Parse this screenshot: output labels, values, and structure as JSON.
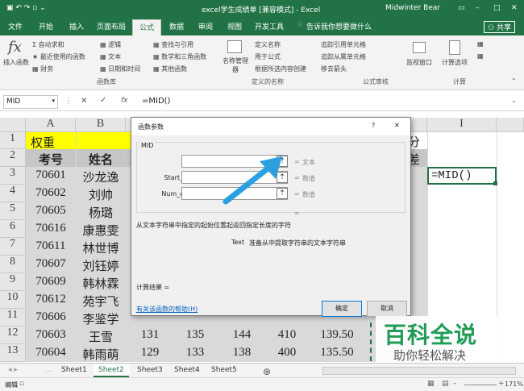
{
  "titlebar": {
    "title": "excel学生成绩单 [兼容模式] - Excel",
    "user": "Midwinter Bear"
  },
  "tabs": [
    "文件",
    "开始",
    "插入",
    "页面布局",
    "公式",
    "数据",
    "审阅",
    "视图",
    "开发工具"
  ],
  "tell_me": "告诉我你想要做什么",
  "share": "共享",
  "ribbon": {
    "insert_function": "插入函数",
    "autosum": "自动求和",
    "recent": "最近使用的函数",
    "finance": "财务",
    "logic": "逻辑",
    "text": "文本",
    "datetime": "日期和时间",
    "lookup": "查找与引用",
    "math": "数学和三角函数",
    "other": "其他函数",
    "group_library": "函数库",
    "name_manager": "名称管理器",
    "define_name": "定义名称",
    "use_in_formula": "用于公式",
    "create_from_sel": "根据所选内容创建",
    "group_names": "定义的名称",
    "trace_prec": "追踪引用单元格",
    "trace_dep": "追踪从属单元格",
    "remove_arrows": "移去箭头",
    "group_audit": "公式审核",
    "watch": "监视窗口",
    "calc_options": "计算选项",
    "group_calc": "计算"
  },
  "formula_bar": {
    "name_box": "MID",
    "fx": "fx",
    "formula": "=MID()"
  },
  "columns": [
    "A",
    "B",
    "I"
  ],
  "rows": [
    "1",
    "2",
    "3",
    "4",
    "5",
    "6",
    "7",
    "8",
    "9",
    "10",
    "11",
    "12",
    "13"
  ],
  "sheet": {
    "a1": "权重",
    "a2": "考号",
    "b2": "姓名",
    "ids": [
      "70601",
      "70602",
      "70605",
      "70616",
      "70611",
      "70607",
      "70609",
      "70612",
      "70606",
      "70603",
      "70604"
    ],
    "names": [
      "沙龙逸",
      "刘帅",
      "杨璐",
      "康惠雯",
      "林世博",
      "刘钰婷",
      "韩林霖",
      "苑宇飞",
      "李鉴学",
      "王雪",
      "韩雨萌"
    ],
    "row12": [
      "131",
      "135",
      "144",
      "410",
      "139.50"
    ],
    "row13": [
      "129",
      "133",
      "138",
      "400",
      "135.50"
    ],
    "partial_h1": "分",
    "partial_h2": "差",
    "active_cell": "=MID()"
  },
  "dialog": {
    "title": "函数参数",
    "help": "?",
    "close": "✕",
    "func": "MID",
    "args": [
      {
        "label": "Text",
        "hint": "文本"
      },
      {
        "label": "Start_num",
        "hint": "数值"
      },
      {
        "label": "Num_chars",
        "hint": "数值"
      }
    ],
    "equals": "=",
    "description": "从文本字符串中指定的起始位置起返回指定长度的字符",
    "arg_desc_label": "Text",
    "arg_desc": "准备从中提取字符串的文本字符串",
    "result": "计算结果 =",
    "help_link": "有关该函数的帮助(H)",
    "ok": "确定",
    "cancel": "取消"
  },
  "sheet_tabs": [
    "Sheet1",
    "Sheet2",
    "Sheet3",
    "Sheet4",
    "Sheet5"
  ],
  "active_sheet": "Sheet2",
  "status": {
    "mode": "编辑",
    "zoom": "171%"
  },
  "watermark": {
    "title": "百科全说",
    "subtitle": "助你轻松解决"
  },
  "colors": {
    "excel_green": "#217346",
    "weight_fill": "#ffff00",
    "arrow": "#2b9fe0"
  }
}
